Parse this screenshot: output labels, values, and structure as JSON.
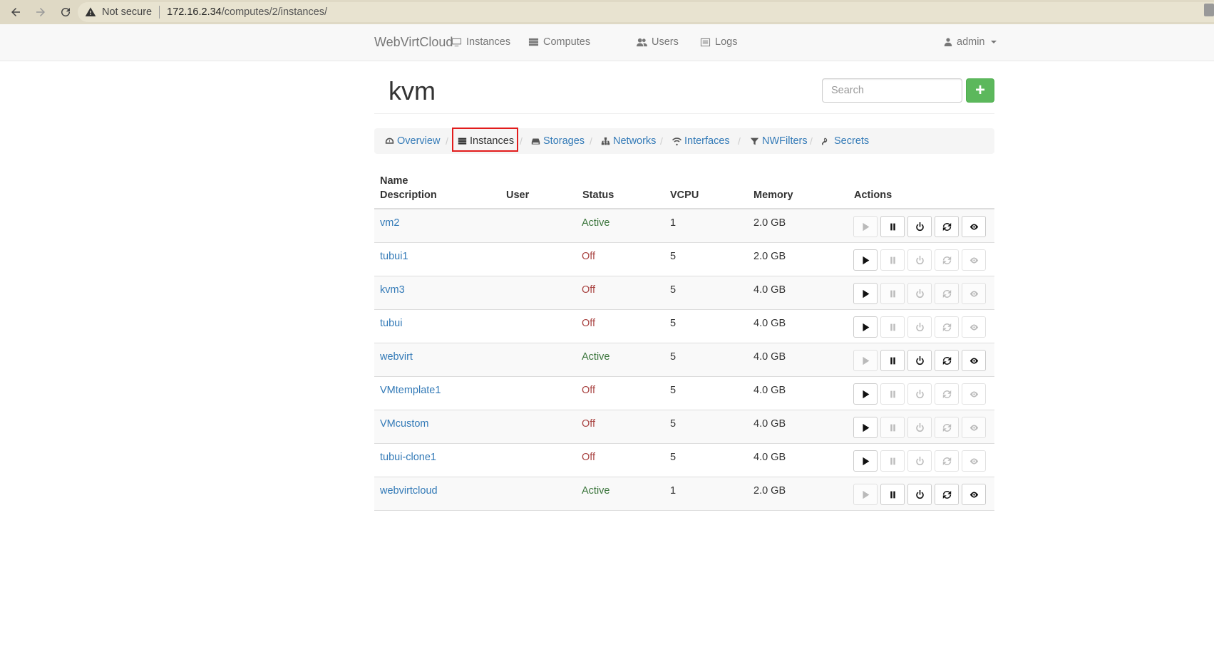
{
  "browser": {
    "not_secure": "Not secure",
    "host": "172.16.2.34",
    "path": "/computes/2/instances/"
  },
  "navbar": {
    "brand": "WebVirtCloud",
    "links": [
      {
        "label": "Instances",
        "icon": "monitor-icon"
      },
      {
        "label": "Computes",
        "icon": "server-icon"
      },
      {
        "label": "Users",
        "icon": "users-icon"
      },
      {
        "label": "Logs",
        "icon": "list-icon"
      }
    ],
    "user": "admin"
  },
  "header": {
    "title": "kvm",
    "search_placeholder": "Search",
    "add_label": "+"
  },
  "breadcrumb": [
    {
      "label": "Overview",
      "icon": "dashboard-icon"
    },
    {
      "label": "Instances",
      "icon": "stack-icon",
      "active": true
    },
    {
      "label": "Storages",
      "icon": "hdd-icon"
    },
    {
      "label": "Networks",
      "icon": "sitemap-icon"
    },
    {
      "label": "Interfaces",
      "icon": "wifi-icon"
    },
    {
      "label": "NWFilters",
      "icon": "filter-icon"
    },
    {
      "label": "Secrets",
      "icon": "key-icon"
    }
  ],
  "table": {
    "headers": {
      "name": "Name",
      "description": "Description",
      "user": "User",
      "status": "Status",
      "vcpu": "VCPU",
      "memory": "Memory",
      "actions": "Actions"
    },
    "rows": [
      {
        "name": "vm2",
        "status": "Active",
        "vcpu": "1",
        "memory": "2.0 GB"
      },
      {
        "name": "tubui1",
        "status": "Off",
        "vcpu": "5",
        "memory": "2.0 GB"
      },
      {
        "name": "kvm3",
        "status": "Off",
        "vcpu": "5",
        "memory": "4.0 GB"
      },
      {
        "name": "tubui",
        "status": "Off",
        "vcpu": "5",
        "memory": "4.0 GB"
      },
      {
        "name": "webvirt",
        "status": "Active",
        "vcpu": "5",
        "memory": "4.0 GB"
      },
      {
        "name": "VMtemplate1",
        "status": "Off",
        "vcpu": "5",
        "memory": "4.0 GB"
      },
      {
        "name": "VMcustom",
        "status": "Off",
        "vcpu": "5",
        "memory": "4.0 GB"
      },
      {
        "name": "tubui-clone1",
        "status": "Off",
        "vcpu": "5",
        "memory": "4.0 GB"
      },
      {
        "name": "webvirtcloud",
        "status": "Active",
        "vcpu": "1",
        "memory": "2.0 GB"
      }
    ]
  },
  "colors": {
    "active": "#3c763d",
    "off": "#a94442",
    "link": "#337ab7",
    "add_button": "#5cb85c",
    "highlight": "#e21c1c"
  }
}
